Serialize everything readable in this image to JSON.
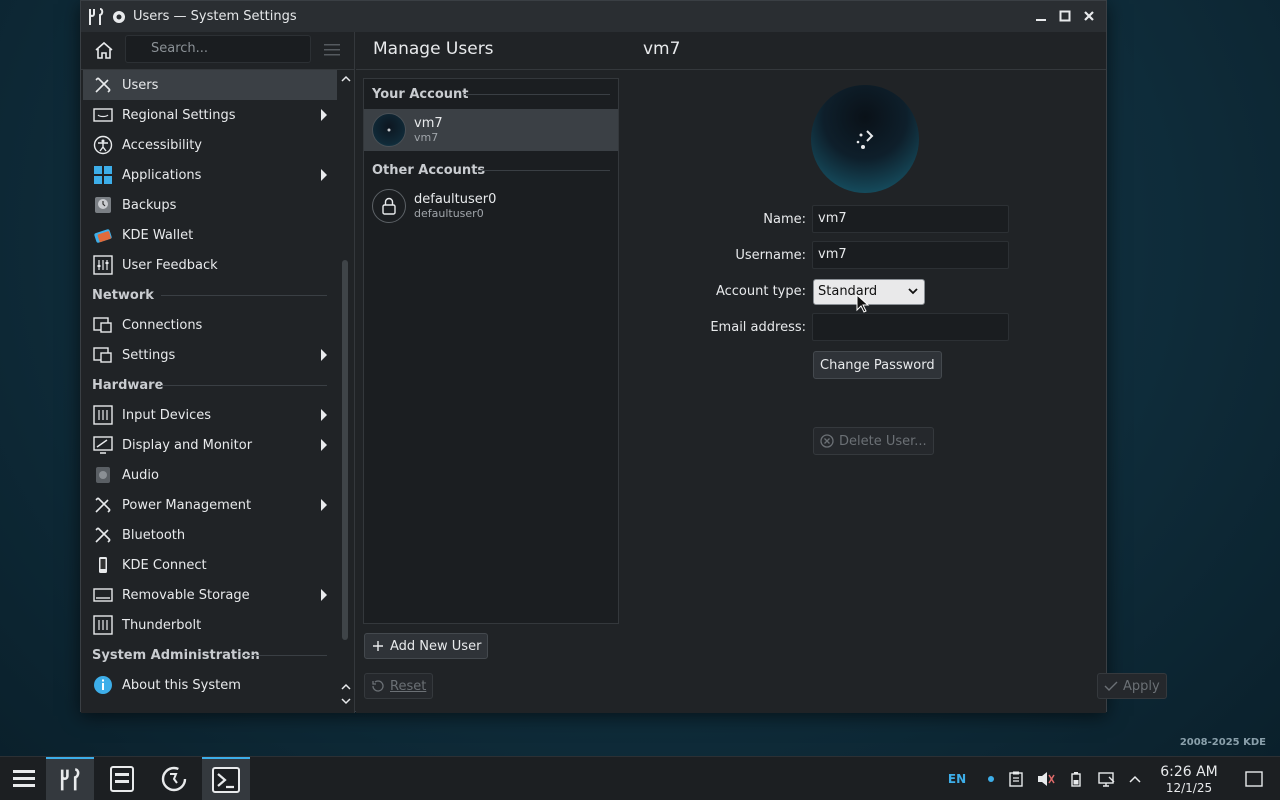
{
  "window": {
    "title": "Users — System Settings"
  },
  "desktop": {
    "credit": "2008-2025 KDE"
  },
  "sidebar": {
    "search_placeholder": "Search...",
    "items": [
      {
        "label": "Users",
        "icon": "users-icon",
        "active": true,
        "submenu": false
      },
      {
        "label": "Regional Settings",
        "icon": "regional-settings-icon",
        "submenu": true
      },
      {
        "label": "Accessibility",
        "icon": "accessibility-icon",
        "submenu": false
      },
      {
        "label": "Applications",
        "icon": "applications-icon",
        "submenu": true
      },
      {
        "label": "Backups",
        "icon": "backups-icon",
        "submenu": false
      },
      {
        "label": "KDE Wallet",
        "icon": "kde-wallet-icon",
        "submenu": false
      },
      {
        "label": "User Feedback",
        "icon": "user-feedback-icon",
        "submenu": false
      }
    ],
    "network_header": "Network",
    "network_items": [
      {
        "label": "Connections",
        "icon": "connections-icon",
        "submenu": false
      },
      {
        "label": "Settings",
        "icon": "network-settings-icon",
        "submenu": true
      }
    ],
    "hardware_header": "Hardware",
    "hardware_items": [
      {
        "label": "Input Devices",
        "icon": "input-devices-icon",
        "submenu": true
      },
      {
        "label": "Display and Monitor",
        "icon": "display-monitor-icon",
        "submenu": true
      },
      {
        "label": "Audio",
        "icon": "audio-icon",
        "submenu": false
      },
      {
        "label": "Power Management",
        "icon": "power-management-icon",
        "submenu": true
      },
      {
        "label": "Bluetooth",
        "icon": "bluetooth-icon",
        "submenu": false
      },
      {
        "label": "KDE Connect",
        "icon": "kde-connect-icon",
        "submenu": false
      },
      {
        "label": "Removable Storage",
        "icon": "removable-storage-icon",
        "submenu": true
      },
      {
        "label": "Thunderbolt",
        "icon": "thunderbolt-icon",
        "submenu": false
      }
    ],
    "sysadmin_header": "System Administration",
    "sysadmin_items": [
      {
        "label": "About this System",
        "icon": "about-system-icon",
        "submenu": false
      }
    ]
  },
  "content": {
    "title": "Manage Users",
    "selected_user_title": "vm7",
    "your_account_header": "Your Account",
    "your_account": {
      "name": "vm7",
      "username": "vm7"
    },
    "other_accounts_header": "Other Accounts",
    "other_accounts": [
      {
        "name": "defaultuser0",
        "username": "defaultuser0"
      }
    ],
    "add_user_label": "Add New User",
    "reset_label": "Reset",
    "apply_label": "Apply",
    "form": {
      "name_label": "Name:",
      "name_value": "vm7",
      "username_label": "Username:",
      "username_value": "vm7",
      "account_type_label": "Account type:",
      "account_type_value": "Standard",
      "email_label": "Email address:",
      "email_value": "",
      "change_password_label": "Change Password",
      "delete_user_label": "Delete User..."
    }
  },
  "taskbar": {
    "items": [
      {
        "icon": "app-launcher-icon"
      },
      {
        "icon": "system-settings-icon",
        "active": true
      },
      {
        "icon": "file-manager-icon"
      },
      {
        "icon": "discover-icon"
      },
      {
        "icon": "terminal-icon",
        "active": true
      }
    ],
    "keyboard_layout": "EN",
    "time": "6:26 AM",
    "date": "12/1/25"
  },
  "colors": {
    "accent": "#3daee9",
    "window_bg": "#202326",
    "selection": "#3b4045"
  }
}
